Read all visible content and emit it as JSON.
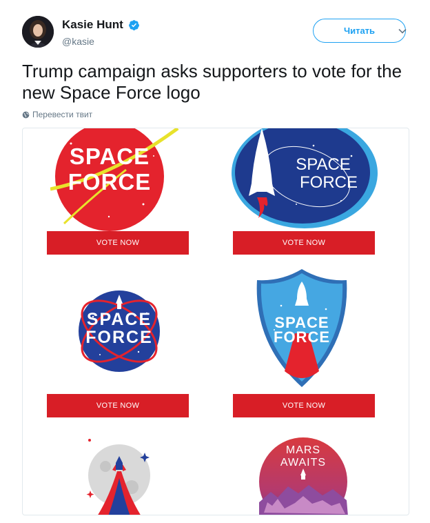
{
  "user": {
    "display_name": "Kasie Hunt",
    "handle": "@kasie",
    "verified": true
  },
  "follow_button_label": "Читать",
  "tweet_text": "Trump campaign asks supporters to vote for the new Space Force logo",
  "translate_label": "Перевести твит",
  "colors": {
    "accent": "#1da1f2",
    "vote_red": "#d81e26",
    "text": "#14171a",
    "muted": "#657786"
  },
  "media": {
    "logos": [
      {
        "line1": "SPACE",
        "line2": "FORCE",
        "vote_label": "VOTE NOW"
      },
      {
        "line1": "SPACE",
        "line2": "FORCE",
        "vote_label": "VOTE NOW"
      },
      {
        "line1": "SPACE",
        "line2": "FORCE",
        "vote_label": "VOTE NOW"
      },
      {
        "line1": "SPACE",
        "line2": "FORCE",
        "vote_label": "VOTE NOW"
      },
      {
        "line1": "",
        "line2": ""
      },
      {
        "line1": "MARS",
        "line2": "AWAITS"
      }
    ]
  }
}
